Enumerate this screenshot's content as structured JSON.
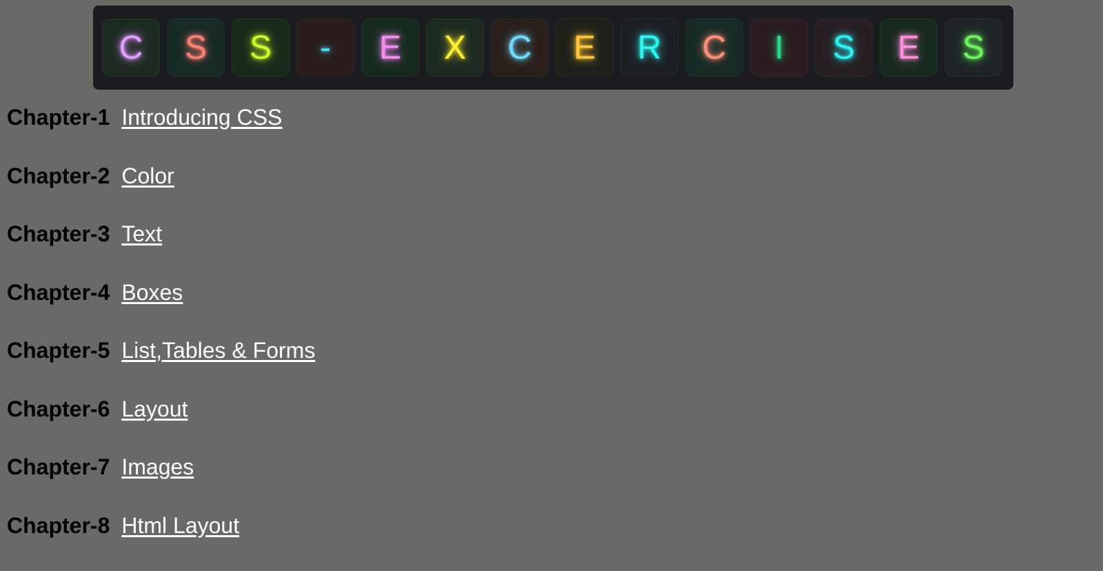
{
  "banner": {
    "letters": [
      {
        "char": "C",
        "color": "#e39bff",
        "tile": "#1d2a22"
      },
      {
        "char": "S",
        "color": "#ff7f74",
        "tile": "#172a26"
      },
      {
        "char": "S",
        "color": "#c8f92a",
        "tile": "#1a2a1a"
      },
      {
        "char": "-",
        "color": "#4dd9ff",
        "tile": "#2a1c1a"
      },
      {
        "char": "E",
        "color": "#f48cf2",
        "tile": "#172a1f"
      },
      {
        "char": "X",
        "color": "#ffef33",
        "tile": "#1d2a22"
      },
      {
        "char": "C",
        "color": "#6fdcff",
        "tile": "#2a1f1a"
      },
      {
        "char": "E",
        "color": "#ffc63b",
        "tile": "#1f201a"
      },
      {
        "char": "R",
        "color": "#2ef5f2",
        "tile": "#1c2025"
      },
      {
        "char": "C",
        "color": "#ff917a",
        "tile": "#172a25"
      },
      {
        "char": "I",
        "color": "#2bd98a",
        "tile": "#2a1c1f"
      },
      {
        "char": "S",
        "color": "#2ff0f0",
        "tile": "#271e23"
      },
      {
        "char": "E",
        "color": "#ff8fd9",
        "tile": "#172a1d"
      },
      {
        "char": "S",
        "color": "#6df55f",
        "tile": "#1f2527"
      }
    ]
  },
  "chapters": [
    {
      "label": "Chapter-1",
      "link": "Introducing CSS"
    },
    {
      "label": "Chapter-2",
      "link": "Color"
    },
    {
      "label": "Chapter-3",
      "link": "Text"
    },
    {
      "label": "Chapter-4",
      "link": "Boxes"
    },
    {
      "label": "Chapter-5",
      "link": "List,Tables & Forms"
    },
    {
      "label": "Chapter-6",
      "link": "Layout"
    },
    {
      "label": "Chapter-7",
      "link": "Images"
    },
    {
      "label": "Chapter-8",
      "link": "Html Layout"
    }
  ]
}
